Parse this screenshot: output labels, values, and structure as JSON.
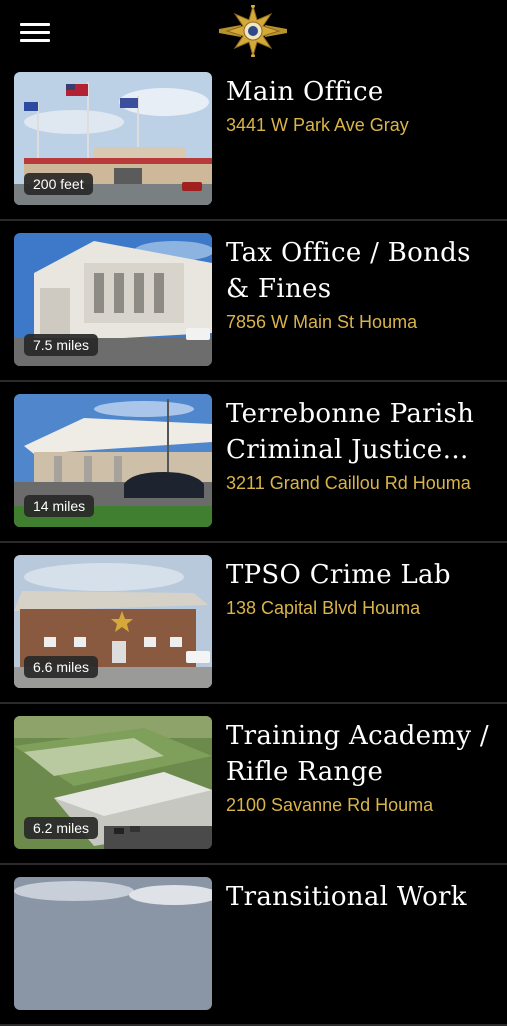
{
  "header": {
    "menu_icon": "hamburger-menu-icon",
    "logo_icon": "sheriff-star-badge-icon"
  },
  "colors": {
    "background": "#000000",
    "title": "#ffffff",
    "address": "#d9b44a",
    "divider": "#2a2a2a"
  },
  "locations": [
    {
      "name": "Main Office",
      "address": "3441 W Park Ave Gray",
      "distance": "200 feet"
    },
    {
      "name": "Tax Office / Bonds & Fines",
      "address": "7856 W Main St Houma",
      "distance": "7.5 miles"
    },
    {
      "name": "Terrebonne Parish Criminal Justice Complex",
      "address": "3211 Grand Caillou Rd Houma",
      "distance": "14 miles"
    },
    {
      "name": "TPSO Crime Lab",
      "address": "138 Capital Blvd Houma",
      "distance": "6.6 miles"
    },
    {
      "name": "Training Academy / Rifle Range",
      "address": "2100 Savanne Rd Houma",
      "distance": "6.2 miles"
    },
    {
      "name": "Transitional Work",
      "address": "",
      "distance": ""
    }
  ]
}
